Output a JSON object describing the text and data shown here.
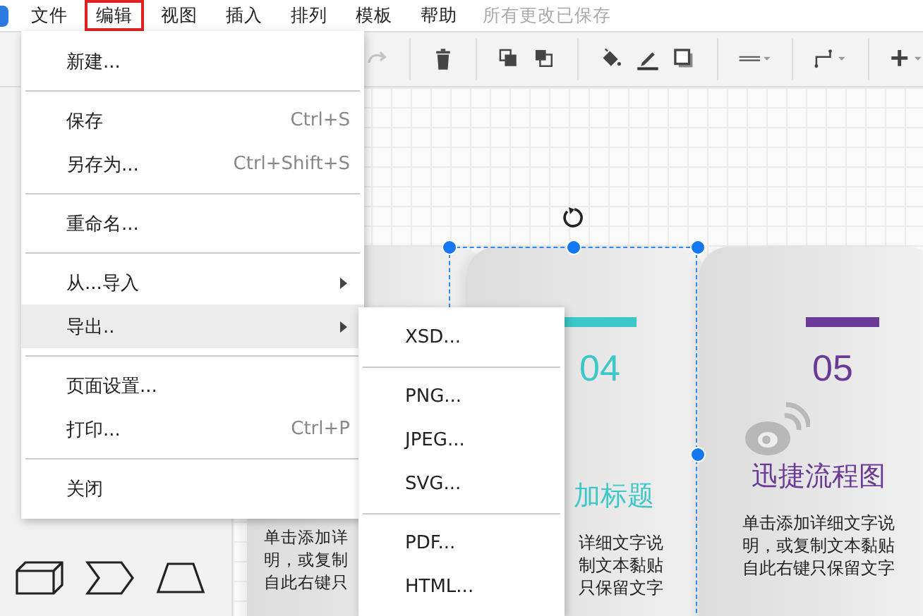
{
  "menubar": {
    "items": [
      {
        "label": "文件",
        "selected": false
      },
      {
        "label": "编辑",
        "selected": true
      },
      {
        "label": "视图",
        "selected": false
      },
      {
        "label": "插入",
        "selected": false
      },
      {
        "label": "排列",
        "selected": false
      },
      {
        "label": "模板",
        "selected": false
      },
      {
        "label": "帮助",
        "selected": false
      }
    ],
    "status": "所有更改已保存"
  },
  "toolbar": {
    "tools": [
      {
        "kind": "redo",
        "disabled": true
      },
      {
        "kind": "delete",
        "disabled": false
      },
      {
        "kind": "front",
        "disabled": false
      },
      {
        "kind": "back",
        "disabled": false
      },
      {
        "kind": "fill",
        "disabled": false
      },
      {
        "kind": "pen",
        "disabled": false
      },
      {
        "kind": "shadow",
        "disabled": false
      },
      {
        "kind": "linestyle",
        "disabled": false
      },
      {
        "kind": "connector",
        "disabled": false
      },
      {
        "kind": "add",
        "disabled": false
      }
    ]
  },
  "canvas": {
    "cards": [
      {
        "description": [
          "单击添加详",
          "明，或复制",
          "自此右键只"
        ]
      },
      {
        "number": "04",
        "title": "加标题",
        "color": "#3cc8c8",
        "description": [
          "详细文字说",
          "制文本黏贴",
          "只保留文字"
        ]
      },
      {
        "number": "05",
        "title": "迅捷流程图",
        "color": "#6a3a96",
        "description": [
          "单击添加详细文字说",
          "明，或复制文本黏贴",
          "自此右键只保留文字"
        ],
        "logo": true
      }
    ]
  },
  "menu": {
    "items": [
      {
        "kind": "item",
        "label": "新建...",
        "submenu": false,
        "selected": false
      },
      {
        "kind": "separator"
      },
      {
        "kind": "item",
        "label": "保存",
        "shortcut": "Ctrl+S",
        "submenu": false,
        "selected": false
      },
      {
        "kind": "item",
        "label": "另存为...",
        "shortcut": "Ctrl+Shift+S",
        "submenu": false,
        "selected": false
      },
      {
        "kind": "separator"
      },
      {
        "kind": "item",
        "label": "重命名...",
        "submenu": false,
        "selected": false
      },
      {
        "kind": "separator"
      },
      {
        "kind": "item",
        "label": "从...导入",
        "submenu": true,
        "selected": false
      },
      {
        "kind": "item",
        "label": "导出..",
        "submenu": true,
        "selected": true
      },
      {
        "kind": "separator"
      },
      {
        "kind": "item",
        "label": "页面设置...",
        "submenu": false,
        "selected": false
      },
      {
        "kind": "item",
        "label": "打印...",
        "shortcut": "Ctrl+P",
        "submenu": false,
        "selected": false
      },
      {
        "kind": "separator"
      },
      {
        "kind": "item",
        "label": "关闭",
        "submenu": false,
        "selected": false
      }
    ]
  },
  "submenu": {
    "items": [
      {
        "kind": "item",
        "label": "XSD..."
      },
      {
        "kind": "separator"
      },
      {
        "kind": "item",
        "label": "PNG..."
      },
      {
        "kind": "item",
        "label": "JPEG..."
      },
      {
        "kind": "item",
        "label": "SVG..."
      },
      {
        "kind": "separator"
      },
      {
        "kind": "item",
        "label": "PDF..."
      },
      {
        "kind": "item",
        "label": "HTML..."
      }
    ]
  }
}
